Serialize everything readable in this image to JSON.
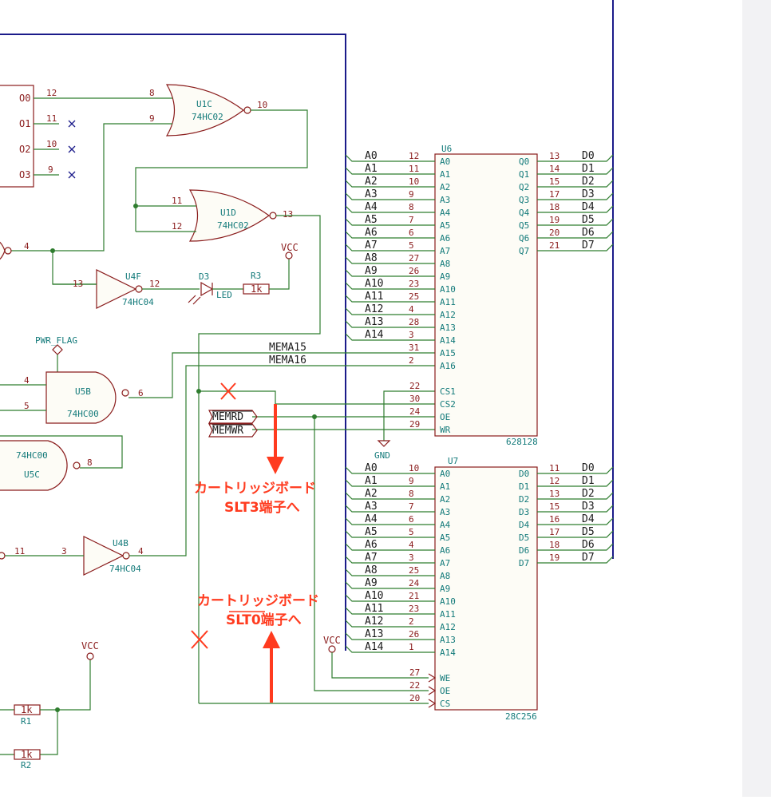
{
  "colors": {
    "wire": "#2f7d2f",
    "bus": "#1b1b8a",
    "symbol": "#8a1c1c",
    "annotation": "#ff3b1f",
    "reference": "#137a7a"
  },
  "gates": {
    "u1c": {
      "ref": "U1C",
      "value": "74HC02",
      "pin_a": "8",
      "pin_b": "9",
      "pin_out": "10"
    },
    "u1d": {
      "ref": "U1D",
      "value": "74HC02",
      "pin_a": "11",
      "pin_b": "12",
      "pin_out": "13"
    },
    "u4f": {
      "ref": "U4F",
      "value": "74HC04",
      "pin_in": "13",
      "pin_out": "12"
    },
    "u5b": {
      "ref": "U5B",
      "value": "74HC00",
      "pin_a": "4",
      "pin_b": "5",
      "pin_out": "6"
    },
    "u5c": {
      "ref": "U5C",
      "value": "74HC00",
      "pin_out": "8"
    },
    "u4b": {
      "ref": "U4B",
      "value": "74HC04",
      "pin_in": "3",
      "pin_out": "4"
    },
    "left_gate_pin": "4",
    "left_gate2_pin": "11"
  },
  "decoder": {
    "outputs": [
      {
        "name": "O0",
        "pin": "12"
      },
      {
        "name": "O1",
        "pin": "11"
      },
      {
        "name": "O2",
        "pin": "10"
      },
      {
        "name": "O3",
        "pin": "9"
      }
    ]
  },
  "led": {
    "ref": "D3",
    "value": "LED"
  },
  "resistors": {
    "r3": {
      "ref": "R3",
      "value": "1k"
    },
    "r1": {
      "ref": "R1",
      "value": "1k"
    },
    "r2": {
      "ref": "R2",
      "value": "1k"
    }
  },
  "power": {
    "vcc": "VCC",
    "gnd": "GND",
    "pwr_flag": "PWR_FLAG"
  },
  "nets": {
    "mema15": "MEMA15",
    "mema16": "MEMA16",
    "memrd": "MEMRD",
    "memwr": "MEMWR"
  },
  "u6": {
    "ref": "U6",
    "value": "628128",
    "addr": [
      {
        "net": "A0",
        "pin": "12",
        "name": "A0"
      },
      {
        "net": "A1",
        "pin": "11",
        "name": "A1"
      },
      {
        "net": "A2",
        "pin": "10",
        "name": "A2"
      },
      {
        "net": "A3",
        "pin": "9",
        "name": "A3"
      },
      {
        "net": "A4",
        "pin": "8",
        "name": "A4"
      },
      {
        "net": "A5",
        "pin": "7",
        "name": "A5"
      },
      {
        "net": "A6",
        "pin": "6",
        "name": "A6"
      },
      {
        "net": "A7",
        "pin": "5",
        "name": "A7"
      },
      {
        "net": "A8",
        "pin": "27",
        "name": "A8"
      },
      {
        "net": "A9",
        "pin": "26",
        "name": "A9"
      },
      {
        "net": "A10",
        "pin": "23",
        "name": "A10"
      },
      {
        "net": "A11",
        "pin": "25",
        "name": "A11"
      },
      {
        "net": "A12",
        "pin": "4",
        "name": "A12"
      },
      {
        "net": "A13",
        "pin": "28",
        "name": "A13"
      },
      {
        "net": "A14",
        "pin": "3",
        "name": "A14"
      },
      {
        "net": "",
        "pin": "31",
        "name": "A15"
      },
      {
        "net": "",
        "pin": "2",
        "name": "A16"
      }
    ],
    "ctrl": [
      {
        "pin": "22",
        "name": "CS1"
      },
      {
        "pin": "30",
        "name": "CS2"
      },
      {
        "pin": "24",
        "name": "OE"
      },
      {
        "pin": "29",
        "name": "WR"
      }
    ],
    "data": [
      {
        "name": "Q0",
        "pin": "13",
        "net": "D0"
      },
      {
        "name": "Q1",
        "pin": "14",
        "net": "D1"
      },
      {
        "name": "Q2",
        "pin": "15",
        "net": "D2"
      },
      {
        "name": "Q3",
        "pin": "17",
        "net": "D3"
      },
      {
        "name": "Q4",
        "pin": "18",
        "net": "D4"
      },
      {
        "name": "Q5",
        "pin": "19",
        "net": "D5"
      },
      {
        "name": "Q6",
        "pin": "20",
        "net": "D6"
      },
      {
        "name": "Q7",
        "pin": "21",
        "net": "D7"
      }
    ]
  },
  "u7": {
    "ref": "U7",
    "value": "28C256",
    "addr": [
      {
        "net": "A0",
        "pin": "10",
        "name": "A0"
      },
      {
        "net": "A1",
        "pin": "9",
        "name": "A1"
      },
      {
        "net": "A2",
        "pin": "8",
        "name": "A2"
      },
      {
        "net": "A3",
        "pin": "7",
        "name": "A3"
      },
      {
        "net": "A4",
        "pin": "6",
        "name": "A4"
      },
      {
        "net": "A5",
        "pin": "5",
        "name": "A5"
      },
      {
        "net": "A6",
        "pin": "4",
        "name": "A6"
      },
      {
        "net": "A7",
        "pin": "3",
        "name": "A7"
      },
      {
        "net": "A8",
        "pin": "25",
        "name": "A8"
      },
      {
        "net": "A9",
        "pin": "24",
        "name": "A9"
      },
      {
        "net": "A10",
        "pin": "21",
        "name": "A10"
      },
      {
        "net": "A11",
        "pin": "23",
        "name": "A11"
      },
      {
        "net": "A12",
        "pin": "2",
        "name": "A12"
      },
      {
        "net": "A13",
        "pin": "26",
        "name": "A13"
      },
      {
        "net": "A14",
        "pin": "1",
        "name": "A14"
      }
    ],
    "ctrl": [
      {
        "pin": "27",
        "name": "WE"
      },
      {
        "pin": "22",
        "name": "OE"
      },
      {
        "pin": "20",
        "name": "CS"
      }
    ],
    "data": [
      {
        "name": "D0",
        "pin": "11",
        "net": "D0"
      },
      {
        "name": "D1",
        "pin": "12",
        "net": "D1"
      },
      {
        "name": "D2",
        "pin": "13",
        "net": "D2"
      },
      {
        "name": "D3",
        "pin": "15",
        "net": "D3"
      },
      {
        "name": "D4",
        "pin": "16",
        "net": "D4"
      },
      {
        "name": "D5",
        "pin": "17",
        "net": "D5"
      },
      {
        "name": "D6",
        "pin": "18",
        "net": "D6"
      },
      {
        "name": "D7",
        "pin": "19",
        "net": "D7"
      }
    ]
  },
  "annotations": {
    "slt3_line1": "カートリッジボード",
    "slt3_line2": "SLT3端子へ",
    "slt0_line1": "カートリッジボード",
    "slt0_line2": "SLT0端子へ"
  }
}
